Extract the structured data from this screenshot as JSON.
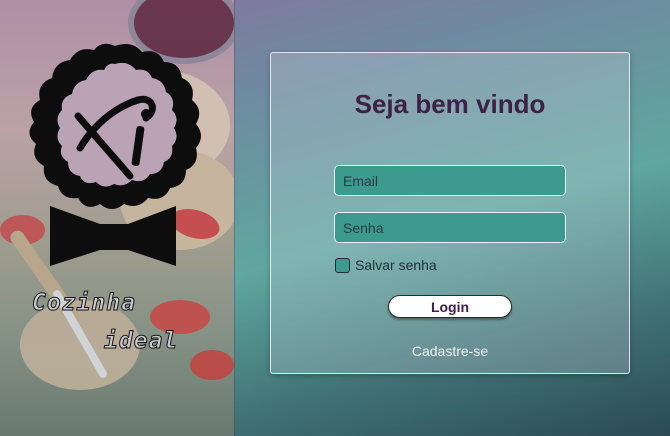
{
  "brand": {
    "line1": "Cozinha",
    "line2": "ideal",
    "logo_icon": "chef-fi-badge-icon",
    "bowtie_icon": "bow-tie-icon"
  },
  "login": {
    "title": "Seja bem vindo",
    "email_placeholder": "Email",
    "password_placeholder": "Senha",
    "remember_label": "Salvar senha",
    "login_label": "Login",
    "signup_label": "Cadastre-se"
  },
  "colors": {
    "title": "#3d2146",
    "field_bg": "#3c9a8e",
    "field_border": "#e9f3f1",
    "button_bg": "#ffffff"
  }
}
